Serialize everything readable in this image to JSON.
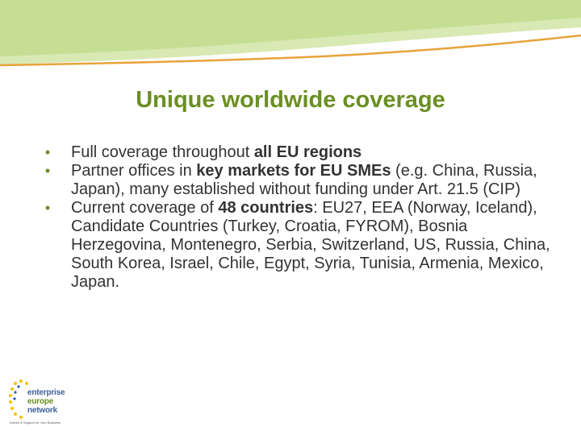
{
  "slide": {
    "title": "Unique worldwide coverage",
    "bullets": [
      {
        "parts": [
          {
            "text": "Full coverage throughout ",
            "bold": false
          },
          {
            "text": "all EU regions",
            "bold": true
          }
        ]
      },
      {
        "parts": [
          {
            "text": "Partner offices in ",
            "bold": false
          },
          {
            "text": "key markets for EU SMEs",
            "bold": true
          },
          {
            "text": " (e.g. China, Russia, Japan), many established without funding under Art. 21.5 (CIP)",
            "bold": false
          }
        ]
      },
      {
        "parts": [
          {
            "text": "Current coverage of ",
            "bold": false
          },
          {
            "text": "48 countries",
            "bold": true
          },
          {
            "text": ": EU27, EEA (Norway, Iceland), Candidate Countries (Turkey, Croatia, FYROM), Bosnia Herzegovina, Montenegro, Serbia, Switzerland, US, Russia, China, South Korea, Israel, Chile, Egypt, Syria, Tunisia, Armenia, Mexico, Japan.",
            "bold": false
          }
        ]
      }
    ]
  },
  "logo": {
    "name": "enterprise-europe-network-logo",
    "lines": [
      "enterprise",
      "europe",
      "network"
    ],
    "tagline": "Advice & Support for Your Business"
  },
  "colors": {
    "title": "#6a8f22",
    "bullet": "#6a8f22",
    "body_text": "#333333",
    "header_green_light": "#cfe3a6",
    "header_green": "#9cc34a",
    "header_orange": "#e8a23a"
  }
}
